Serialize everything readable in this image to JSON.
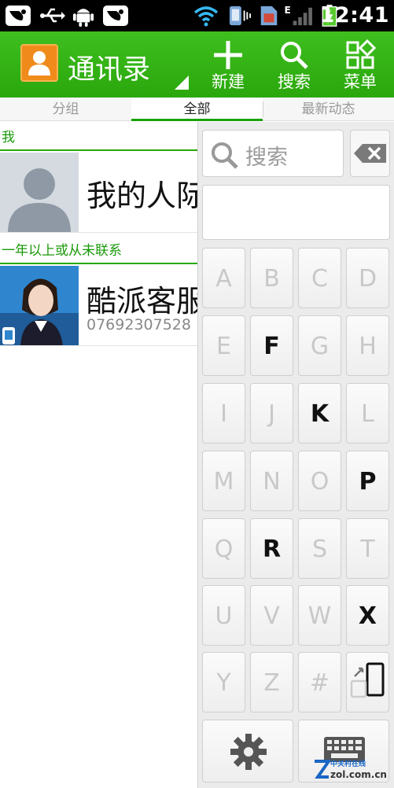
{
  "status_bar": {
    "time": "12:41",
    "network": "E",
    "icons": [
      "app-notification-icon",
      "usb-icon",
      "android-debug-icon",
      "app-notification-icon",
      "wifi-icon",
      "vibrate-icon",
      "sim-icon",
      "signal-icon",
      "battery-charging-icon"
    ]
  },
  "header": {
    "title": "通讯录",
    "buttons": [
      {
        "label": "新建",
        "icon": "plus-icon"
      },
      {
        "label": "搜索",
        "icon": "search-icon"
      },
      {
        "label": "菜单",
        "icon": "menu-grid-icon"
      }
    ]
  },
  "tabs": [
    {
      "label": "分组",
      "active": false
    },
    {
      "label": "全部",
      "active": true
    },
    {
      "label": "最新动态",
      "active": false
    }
  ],
  "contacts": {
    "section_me": "我",
    "me_name": "我的人际",
    "section_inactive": "一年以上或从未联系",
    "service_name": "酷派客服",
    "service_phone": "07692307528"
  },
  "keyboard": {
    "search_placeholder": "搜索",
    "keys": [
      {
        "label": "A",
        "enabled": false
      },
      {
        "label": "B",
        "enabled": false
      },
      {
        "label": "C",
        "enabled": false
      },
      {
        "label": "D",
        "enabled": false
      },
      {
        "label": "E",
        "enabled": false
      },
      {
        "label": "F",
        "enabled": true
      },
      {
        "label": "G",
        "enabled": false
      },
      {
        "label": "H",
        "enabled": false
      },
      {
        "label": "I",
        "enabled": false
      },
      {
        "label": "J",
        "enabled": false
      },
      {
        "label": "K",
        "enabled": true
      },
      {
        "label": "L",
        "enabled": false
      },
      {
        "label": "M",
        "enabled": false
      },
      {
        "label": "N",
        "enabled": false
      },
      {
        "label": "O",
        "enabled": false
      },
      {
        "label": "P",
        "enabled": true
      },
      {
        "label": "Q",
        "enabled": false
      },
      {
        "label": "R",
        "enabled": true
      },
      {
        "label": "S",
        "enabled": false
      },
      {
        "label": "T",
        "enabled": false
      },
      {
        "label": "U",
        "enabled": false
      },
      {
        "label": "V",
        "enabled": false
      },
      {
        "label": "W",
        "enabled": false
      },
      {
        "label": "X",
        "enabled": true
      },
      {
        "label": "Y",
        "enabled": false
      },
      {
        "label": "Z",
        "enabled": false
      },
      {
        "label": "#",
        "enabled": false
      }
    ]
  },
  "watermark": {
    "name": "中关村在线",
    "url": "zol.com.cn"
  },
  "colors": {
    "header_green": "#2aa70c",
    "section_green": "#1a9a0a",
    "disabled_key_text": "#c8c8c8"
  }
}
